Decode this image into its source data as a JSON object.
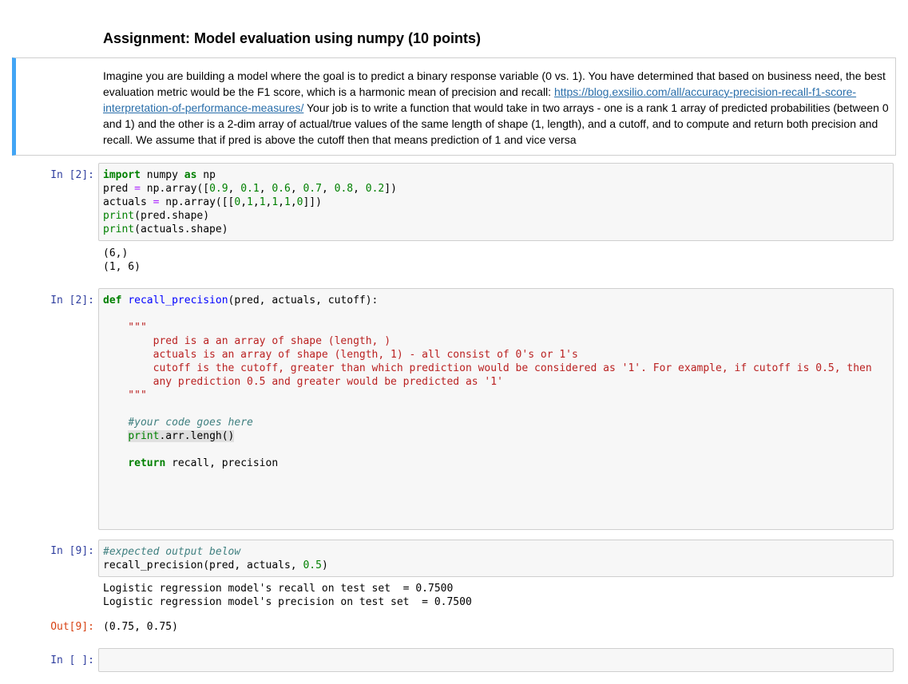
{
  "heading": "Assignment: Model evaluation using numpy (10 points)",
  "markdown": {
    "text_before_link": "Imagine you are building a model where the goal is to predict a binary response variable (0 vs. 1). You have determined that based on business need, the best evaluation metric would be the F1 score, which is a harmonic mean of precision and recall: ",
    "link_text": "https://blog.exsilio.com/all/accuracy-precision-recall-f1-score-interpretation-of-performance-measures/",
    "text_after_link": " Your job is to write a function that would take in two arrays - one is a rank 1 array of predicted probabilities (between 0 and 1) and the other is a 2-dim array of actual/true values of the same length of shape (1, length), and a cutoff, and to compute and return both precision and recall. We assume that if pred is above the cutoff then that means prediction of 1 and vice versa"
  },
  "cells": {
    "c1": {
      "prompt": "In [2]:",
      "kw_import": "import",
      "mod_numpy": " numpy ",
      "kw_as": "as",
      "alias_np": " np",
      "l2_a": "pred ",
      "l2_eq": "=",
      "l2_b": " np.array([",
      "l2_n1": "0.9",
      "l2_n2": "0.1",
      "l2_n3": "0.6",
      "l2_n4": "0.7",
      "l2_n5": "0.8",
      "l2_n6": "0.2",
      "l2_c": "])",
      "l3_a": "actuals ",
      "l3_eq": "=",
      "l3_b": " np.array([[",
      "l3_n1": "0",
      "l3_n2": "1",
      "l3_n3": "1",
      "l3_n4": "1",
      "l3_n5": "1",
      "l3_n6": "0",
      "l3_c": "]])",
      "print_kw": "print",
      "l4_rest": "(pred.shape)",
      "l5_rest": "(actuals.shape)",
      "output": "(6,)\n(1, 6)"
    },
    "c2": {
      "prompt": "In [2]:",
      "kw_def": "def",
      "fn_name": "recall_precision",
      "sig_rest": "(pred, actuals, cutoff):",
      "docstring": "    \"\"\"\n        pred is a an array of shape (length, )\n        actuals is an array of shape (length, 1) - all consist of 0's or 1's\n        cutoff is the cutoff, greater than which prediction would be considered as '1'. For example, if cutoff is 0.5, then\n        any prediction 0.5 and greater would be predicted as '1'\n    \"\"\"",
      "comment": "#your code goes here",
      "print_kw": "print",
      "print_rest": ".arr.lengh()",
      "kw_return": "return",
      "return_rest": " recall, precision"
    },
    "c3": {
      "prompt": "In [9]:",
      "comment": "#expected output below",
      "call_a": "recall_precision(pred, actuals, ",
      "call_num": "0.5",
      "call_c": ")",
      "output": "Logistic regression model's recall on test set  = 0.7500\nLogistic regression model's precision on test set  = 0.7500",
      "out_prompt": "Out[9]:",
      "out_value": "(0.75, 0.75)"
    },
    "c4": {
      "prompt": "In [ ]:"
    }
  }
}
